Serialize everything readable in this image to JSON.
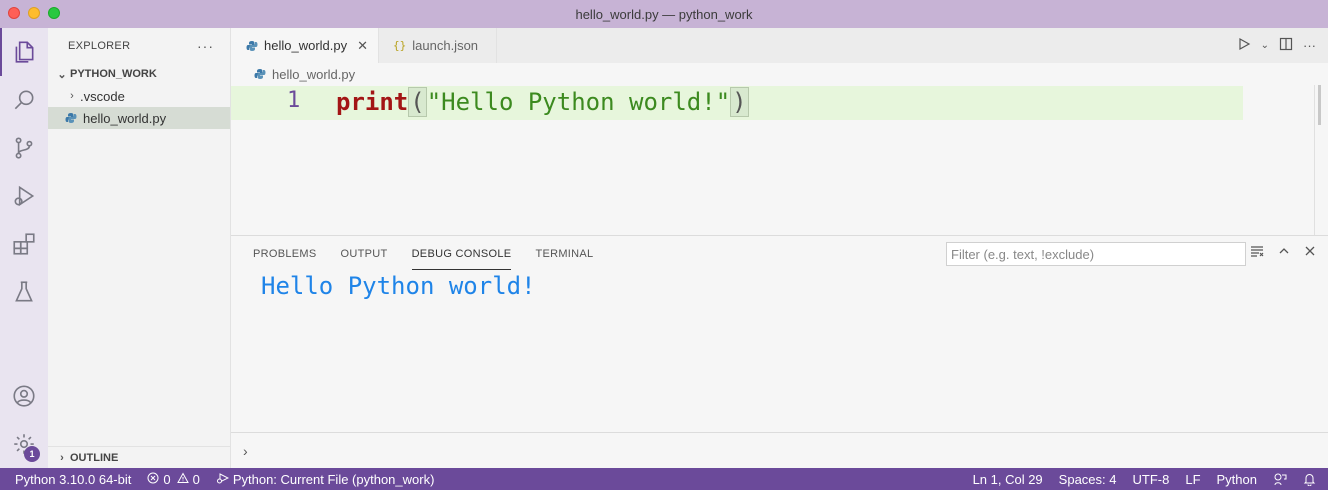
{
  "window": {
    "title": "hello_world.py — python_work"
  },
  "colors": {
    "accent": "#6b4a9a",
    "titlebar": "#c7b3d5",
    "line_highlight": "#e7f6dc"
  },
  "activity_bar": {
    "icons": [
      "explorer-icon",
      "search-icon",
      "source-control-icon",
      "run-debug-icon",
      "extensions-icon",
      "testing-icon",
      "account-icon",
      "settings-gear-icon"
    ],
    "settings_badge": "1"
  },
  "sidebar": {
    "title": "EXPLORER",
    "more": "···",
    "folder": "PYTHON_WORK",
    "items": [
      {
        "label": ".vscode",
        "type": "folder"
      },
      {
        "label": "hello_world.py",
        "type": "python-file",
        "selected": true
      }
    ],
    "outline": "OUTLINE"
  },
  "editor": {
    "tabs": [
      {
        "label": "hello_world.py",
        "active": true,
        "close": "✕"
      },
      {
        "label": "launch.json",
        "active": false,
        "icon_text": "{}"
      }
    ],
    "breadcrumb": "hello_world.py",
    "line_number": "1",
    "code": {
      "fn": "print",
      "open": "(",
      "string": "\"Hello Python world!\"",
      "close": ")"
    }
  },
  "panel": {
    "tabs": [
      "PROBLEMS",
      "OUTPUT",
      "DEBUG CONSOLE",
      "TERMINAL"
    ],
    "active_tab": "DEBUG CONSOLE",
    "filter_placeholder": "Filter (e.g. text, !exclude)",
    "output": "Hello Python world!",
    "prompt": "›"
  },
  "statusbar": {
    "interpreter": "Python 3.10.0 64-bit",
    "errors": "0",
    "warnings": "0",
    "debug_config": "Python: Current File (python_work)",
    "position": "Ln 1, Col 29",
    "spaces": "Spaces: 4",
    "encoding": "UTF-8",
    "eol": "LF",
    "language": "Python"
  }
}
